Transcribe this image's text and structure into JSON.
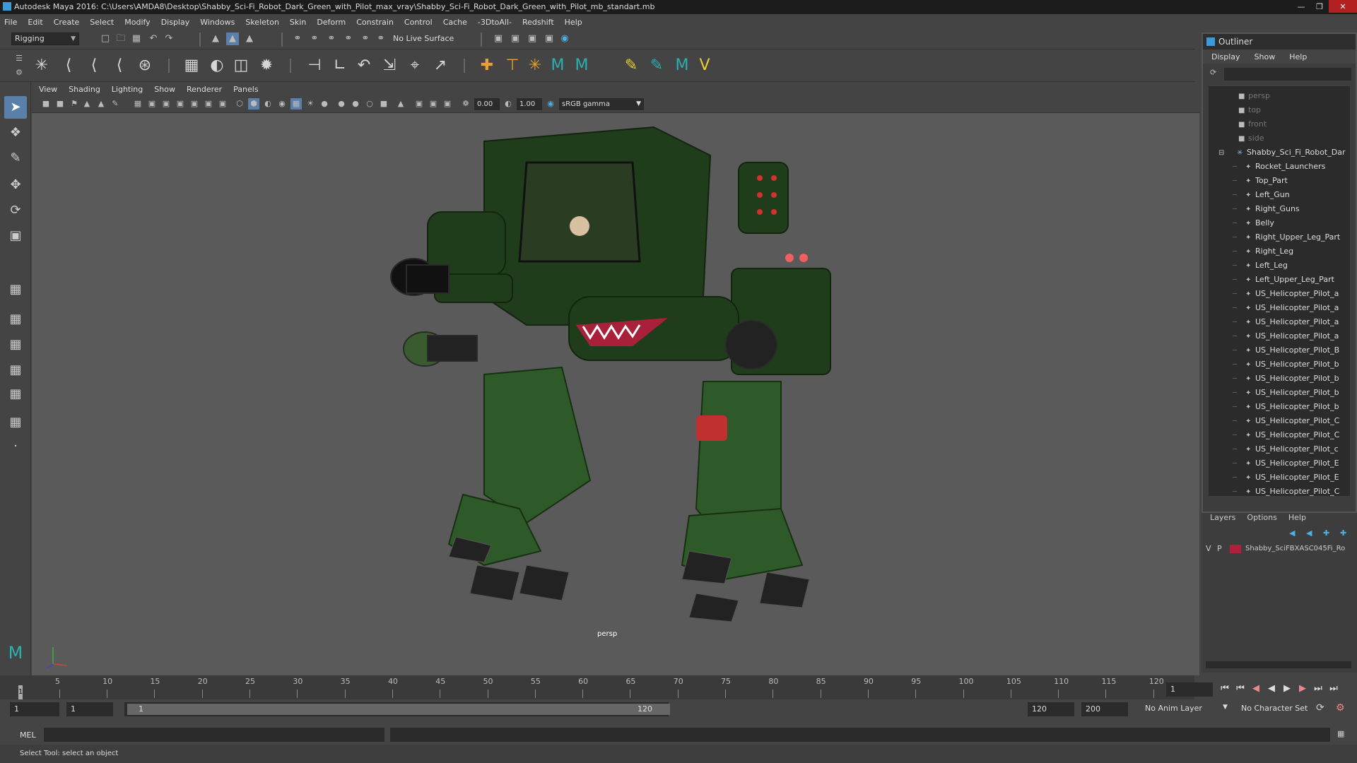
{
  "window": {
    "title": "Autodesk Maya 2016: C:\\Users\\AMDA8\\Desktop\\Shabby_Sci-Fi_Robot_Dark_Green_with_Pilot_max_vray\\Shabby_Sci-Fi_Robot_Dark_Green_with_Pilot_mb_standart.mb"
  },
  "menu": [
    "File",
    "Edit",
    "Create",
    "Select",
    "Modify",
    "Display",
    "Windows",
    "Skeleton",
    "Skin",
    "Deform",
    "Constrain",
    "Control",
    "Cache",
    "-3DtoAll-",
    "Redshift",
    "Help"
  ],
  "toolbar": {
    "mode": "Rigging",
    "live_surface": "No Live Surface"
  },
  "viewport": {
    "menu": [
      "View",
      "Shading",
      "Lighting",
      "Show",
      "Renderer",
      "Panels"
    ],
    "exposure": "0.00",
    "gamma": "1.00",
    "color_space": "sRGB gamma",
    "camera_label": "persp"
  },
  "outliner": {
    "title": "Outliner",
    "menu": [
      "Display",
      "Show",
      "Help"
    ],
    "cameras": [
      "persp",
      "top",
      "front",
      "side"
    ],
    "root": "Shabby_Sci_Fi_Robot_Dar",
    "children": [
      "Rocket_Launchers",
      "Top_Part",
      "Left_Gun",
      "Right_Guns",
      "Belly",
      "Right_Upper_Leg_Part",
      "Right_Leg",
      "Left_Leg",
      "Left_Upper_Leg_Part",
      "US_Helicopter_Pilot_a",
      "US_Helicopter_Pilot_a",
      "US_Helicopter_Pilot_a",
      "US_Helicopter_Pilot_a",
      "US_Helicopter_Pilot_B",
      "US_Helicopter_Pilot_b",
      "US_Helicopter_Pilot_b",
      "US_Helicopter_Pilot_b",
      "US_Helicopter_Pilot_b",
      "US_Helicopter_Pilot_C",
      "US_Helicopter_Pilot_C",
      "US_Helicopter_Pilot_c",
      "US_Helicopter_Pilot_E",
      "US_Helicopter_Pilot_E",
      "US_Helicopter_Pilot_C"
    ]
  },
  "layers": {
    "menu": [
      "Layers",
      "Options",
      "Help"
    ],
    "row": {
      "v": "V",
      "p": "P",
      "name": "Shabby_SciFBXASC045Fi_Ro",
      "color": "#b0203a"
    }
  },
  "timeline": {
    "ticks": [
      "5",
      "10",
      "15",
      "20",
      "25",
      "30",
      "35",
      "40",
      "45",
      "50",
      "55",
      "60",
      "65",
      "70",
      "75",
      "80",
      "85",
      "90",
      "95",
      "100",
      "105",
      "110",
      "115",
      "120"
    ],
    "current_frame": "1",
    "frame_field": "1"
  },
  "range": {
    "start": "1",
    "anim_start": "1",
    "slider_start": "1",
    "slider_end": "120",
    "end": "120",
    "anim_end": "200",
    "anim_layer": "No Anim Layer",
    "char_set": "No Character Set"
  },
  "cmd": {
    "label": "MEL"
  },
  "help": {
    "text": "Select Tool: select an object"
  }
}
